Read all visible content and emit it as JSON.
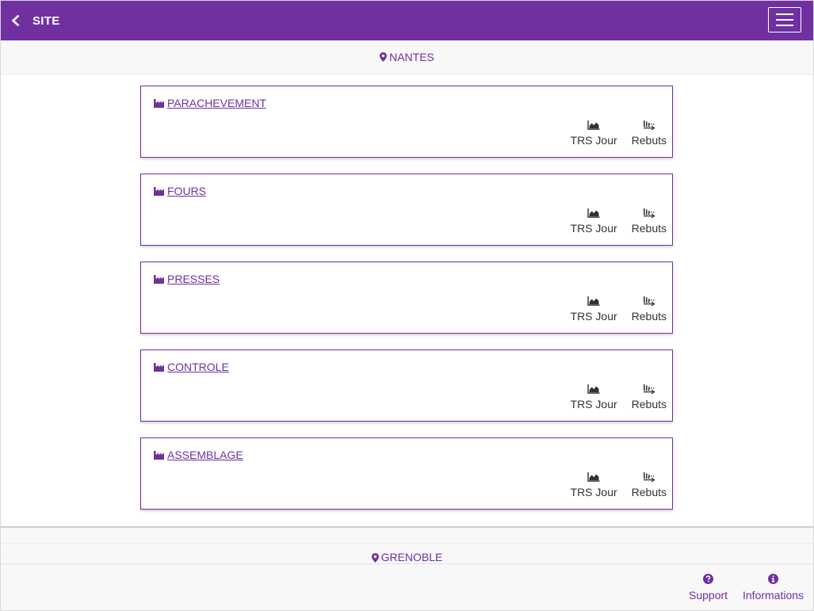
{
  "header": {
    "back_icon": "chevron-left-icon",
    "title": "SITE",
    "menu_icon": "hamburger-icon"
  },
  "sites": [
    {
      "name": "NANTES",
      "icon": "map-marker-icon",
      "workshops": [
        {
          "name": "PARACHEVEMENT",
          "icon": "industry-icon"
        },
        {
          "name": "FOURS",
          "icon": "industry-icon"
        },
        {
          "name": "PRESSES",
          "icon": "industry-icon"
        },
        {
          "name": "CONTROLE",
          "icon": "industry-icon"
        },
        {
          "name": "ASSEMBLAGE",
          "icon": "industry-icon"
        }
      ]
    },
    {
      "name": "GRENOBLE",
      "icon": "map-marker-icon",
      "workshops": []
    }
  ],
  "card_actions": {
    "trs_label": "TRS Jour",
    "trs_icon": "area-chart-icon",
    "rebuts_label": "Rebuts",
    "rebuts_icon": "rebuts-icon"
  },
  "footer": {
    "support_label": "Support",
    "support_icon": "question-circle-icon",
    "info_label": "Informations",
    "info_icon": "info-circle-icon"
  },
  "colors": {
    "brand": "#7030a0",
    "text": "#333333",
    "band": "#f8f8f8"
  }
}
